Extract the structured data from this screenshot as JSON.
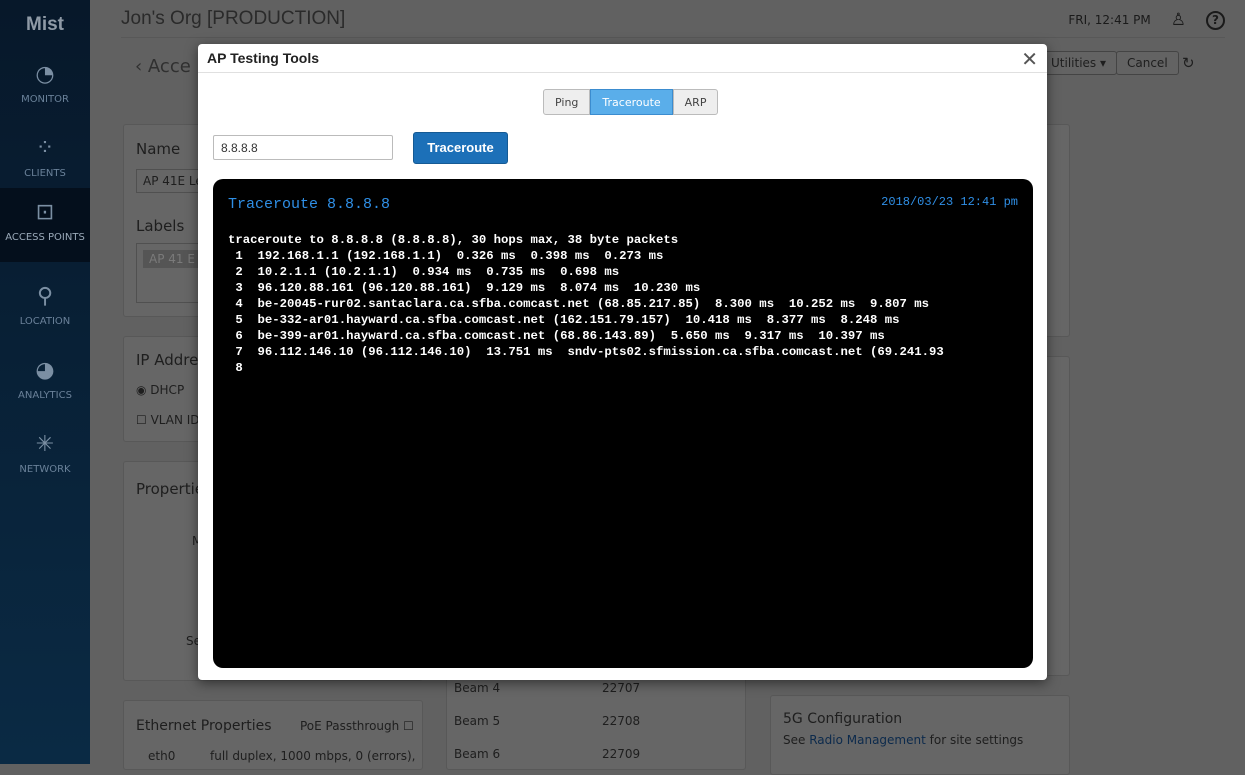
{
  "sidebar": {
    "logo": "Mist",
    "items": [
      {
        "label": "MONITOR",
        "icon": "gauge-icon"
      },
      {
        "label": "CLIENTS",
        "icon": "clients-icon"
      },
      {
        "label": "ACCESS POINTS",
        "icon": "access-point-icon"
      },
      {
        "label": "LOCATION",
        "icon": "location-pin-icon"
      },
      {
        "label": "ANALYTICS",
        "icon": "pie-chart-icon"
      },
      {
        "label": "NETWORK",
        "icon": "network-icon"
      }
    ]
  },
  "header": {
    "org": "Jon's Org [PRODUCTION]",
    "time": "FRI, 12:41 PM"
  },
  "page": {
    "back": "Acce",
    "utilities": "Utilities",
    "cancel": "Cancel",
    "name_label": "Name",
    "name_value": "AP 41E Le",
    "labels_label": "Labels",
    "label_tag": "AP 41 E",
    "ip_label": "IP Addre",
    "dhcp": "DHCP",
    "vlan": "VLAN ID",
    "properties": "Properties",
    "prop_m": "M",
    "prop_se": "Se",
    "ethernet": "Ethernet Properties",
    "poe": "PoE Passthrough",
    "eth0": "eth0",
    "eth0_value": "full duplex, 1000 mbps, 0 (errors),",
    "beams": [
      {
        "name": "Beam 4",
        "value": "22707"
      },
      {
        "name": "Beam 5",
        "value": "22708"
      },
      {
        "name": "Beam 6",
        "value": "22709"
      }
    ],
    "g5_title": "5G Configuration",
    "g5_see": "See",
    "g5_link": "Radio Management",
    "g5_rest": "for site settings"
  },
  "modal": {
    "title": "AP Testing Tools",
    "tabs": [
      "Ping",
      "Traceroute",
      "ARP"
    ],
    "active_tab": "Traceroute",
    "target": "8.8.8.8",
    "run": "Traceroute",
    "terminal": {
      "title": "Traceroute 8.8.8.8",
      "timestamp": "2018/03/23 12:41 pm",
      "output": "traceroute to 8.8.8.8 (8.8.8.8), 30 hops max, 38 byte packets\n 1  192.168.1.1 (192.168.1.1)  0.326 ms  0.398 ms  0.273 ms\n 2  10.2.1.1 (10.2.1.1)  0.934 ms  0.735 ms  0.698 ms\n 3  96.120.88.161 (96.120.88.161)  9.129 ms  8.074 ms  10.230 ms\n 4  be-20045-rur02.santaclara.ca.sfba.comcast.net (68.85.217.85)  8.300 ms  10.252 ms  9.807 ms\n 5  be-332-ar01.hayward.ca.sfba.comcast.net (162.151.79.157)  10.418 ms  8.377 ms  8.248 ms\n 6  be-399-ar01.hayward.ca.sfba.comcast.net (68.86.143.89)  5.650 ms  9.317 ms  10.397 ms\n 7  96.112.146.10 (96.112.146.10)  13.751 ms  sndv-pts02.sfmission.ca.sfba.comcast.net (69.241.93\n 8"
    }
  }
}
